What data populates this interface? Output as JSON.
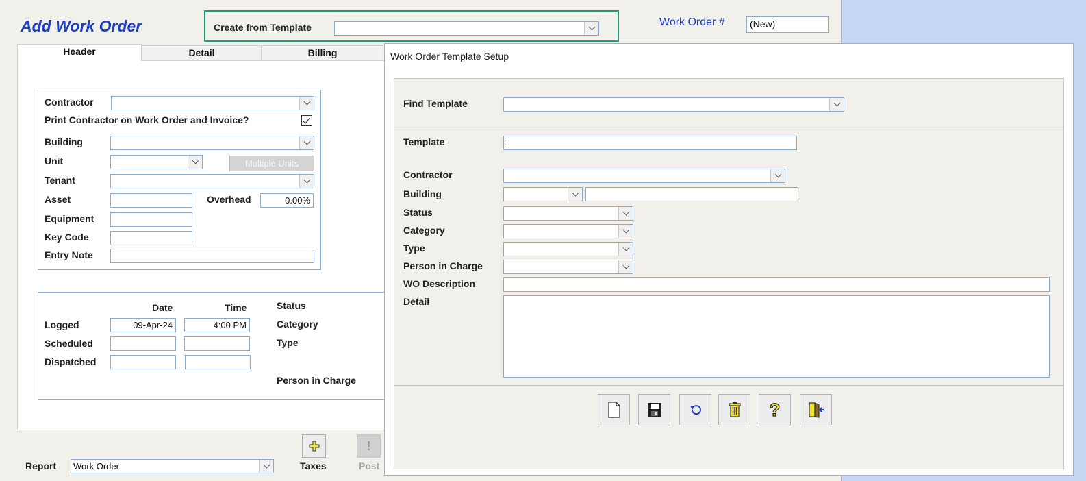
{
  "main": {
    "title": "Add Work Order",
    "create_from_template_label": "Create from Template",
    "create_from_template_value": "",
    "work_order_number_label": "Work Order #",
    "work_order_number_value": "(New)"
  },
  "tabs": [
    {
      "label": "Header"
    },
    {
      "label": "Detail"
    },
    {
      "label": "Billing"
    }
  ],
  "header_panel": {
    "contractor_label": "Contractor",
    "print_contractor_label": "Print Contractor on Work Order and Invoice?",
    "print_contractor_checked": true,
    "building_label": "Building",
    "unit_label": "Unit",
    "multiple_units_label": "Multiple Units",
    "tenant_label": "Tenant",
    "asset_label": "Asset",
    "overhead_label": "Overhead",
    "overhead_value": "0.00%",
    "equipment_label": "Equipment",
    "key_code_label": "Key Code",
    "entry_note_label": "Entry Note"
  },
  "dates_panel": {
    "date_header": "Date",
    "time_header": "Time",
    "logged_label": "Logged",
    "logged_date": "09-Apr-24",
    "logged_time": "4:00 PM",
    "scheduled_label": "Scheduled",
    "dispatched_label": "Dispatched",
    "status_label": "Status",
    "category_label": "Category",
    "type_label": "Type",
    "person_in_charge_label": "Person in Charge"
  },
  "bottom": {
    "report_label": "Report",
    "report_value": "Work Order",
    "taxes_label": "Taxes",
    "post_label": "Post"
  },
  "dialog": {
    "title": "Work Order Template Setup",
    "find_template_label": "Find Template",
    "template_label": "Template",
    "contractor_label": "Contractor",
    "building_label": "Building",
    "status_label": "Status",
    "category_label": "Category",
    "type_label": "Type",
    "person_in_charge_label": "Person in Charge",
    "wo_description_label": "WO Description",
    "detail_label": "Detail",
    "toolbar_icons": [
      "new-document-icon",
      "save-icon",
      "undo-icon",
      "delete-icon",
      "help-icon",
      "exit-icon"
    ]
  },
  "colors": {
    "title_blue": "#1a3fc4",
    "highlight_border": "#1e9b78",
    "desktop_bg": "#c5d9f5"
  }
}
